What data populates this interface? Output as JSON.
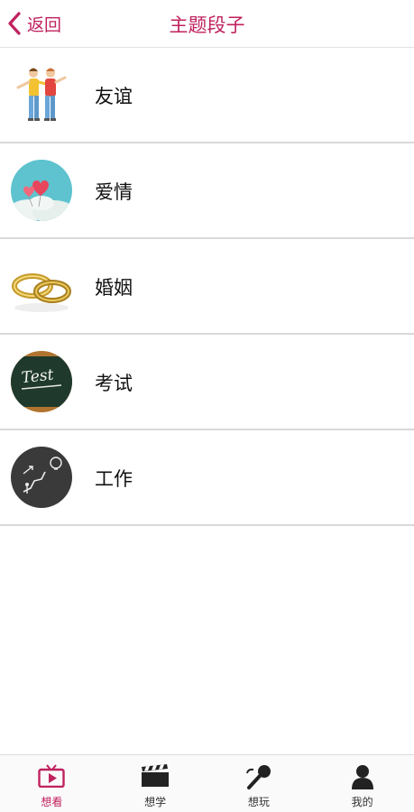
{
  "header": {
    "back_label": "返回",
    "title": "主题段子"
  },
  "topics": [
    {
      "label": "友谊",
      "icon": "friends-icon"
    },
    {
      "label": "爱情",
      "icon": "hearts-icon"
    },
    {
      "label": "婚姻",
      "icon": "rings-icon"
    },
    {
      "label": "考试",
      "icon": "test-blackboard-icon"
    },
    {
      "label": "工作",
      "icon": "work-chalkboard-icon"
    }
  ],
  "tabs": [
    {
      "label": "想看",
      "icon": "tv-icon",
      "active": true
    },
    {
      "label": "想学",
      "icon": "clapperboard-icon",
      "active": false
    },
    {
      "label": "想玩",
      "icon": "microphone-icon",
      "active": false
    },
    {
      "label": "我的",
      "icon": "person-icon",
      "active": false
    }
  ],
  "colors": {
    "accent": "#c0215e",
    "text": "#111111",
    "divider": "#d9d9d9"
  }
}
